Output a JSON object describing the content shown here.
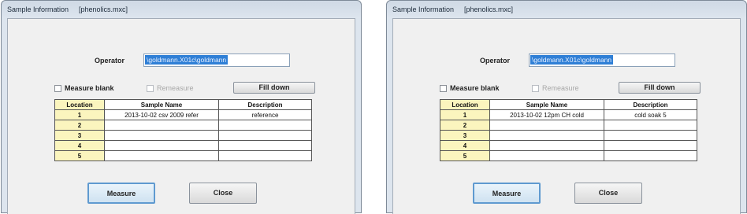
{
  "dialogs": [
    {
      "title": "Sample Information",
      "file": "[phenolics.mxc]",
      "operator_label": "Operator",
      "operator_value": "\\goldmann.X01c\\goldmann",
      "measure_blank_label": "Measure blank",
      "remeasure_label": "Remeasure",
      "fill_down_label": "Fill down",
      "table": {
        "headers": [
          "Location",
          "Sample Name",
          "Description"
        ],
        "rows": [
          {
            "location": "1",
            "name": "2013-10-02 csv 2009 refer",
            "description": "reference"
          },
          {
            "location": "2",
            "name": "",
            "description": ""
          },
          {
            "location": "3",
            "name": "",
            "description": ""
          },
          {
            "location": "4",
            "name": "",
            "description": ""
          },
          {
            "location": "5",
            "name": "",
            "description": ""
          }
        ]
      },
      "measure_label": "Measure",
      "close_label": "Close"
    },
    {
      "title": "Sample Information",
      "file": "[phenolics.mxc]",
      "operator_label": "Operator",
      "operator_value": "\\goldmann.X01c\\goldmann",
      "measure_blank_label": "Measure blank",
      "remeasure_label": "Remeasure",
      "fill_down_label": "Fill down",
      "table": {
        "headers": [
          "Location",
          "Sample Name",
          "Description"
        ],
        "rows": [
          {
            "location": "1",
            "name": "2013-10-02 12pm CH cold",
            "description": "cold soak 5"
          },
          {
            "location": "2",
            "name": "",
            "description": ""
          },
          {
            "location": "3",
            "name": "",
            "description": ""
          },
          {
            "location": "4",
            "name": "",
            "description": ""
          },
          {
            "location": "5",
            "name": "",
            "description": ""
          }
        ]
      },
      "measure_label": "Measure",
      "close_label": "Close"
    }
  ],
  "colors": {
    "header_fill": "#fbf5be",
    "selection": "#2f7fd6",
    "default_button_border": "#5f9ad0"
  }
}
